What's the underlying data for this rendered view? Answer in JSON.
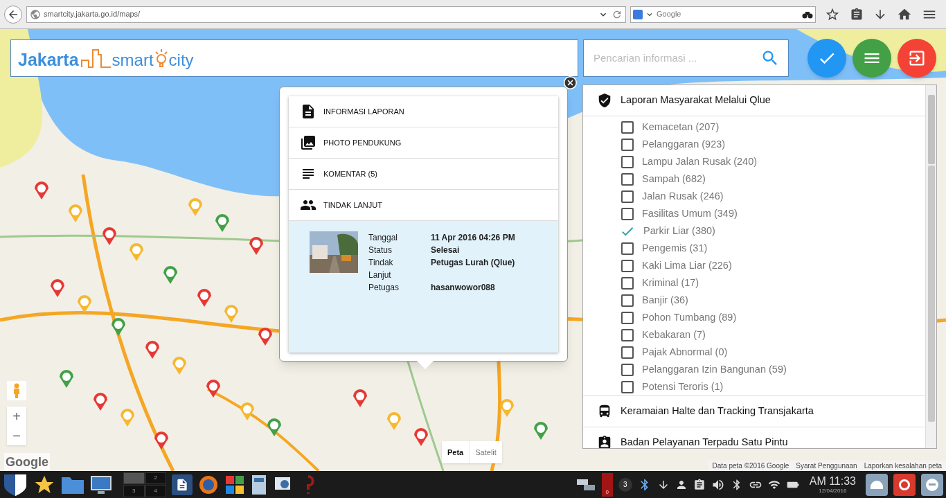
{
  "browser": {
    "url": "smartcity.jakarta.go.id/maps/",
    "search_placeholder": "Google"
  },
  "header": {
    "logo": {
      "word_1": "Jakarta",
      "word_2": "smart",
      "word_3": "city"
    },
    "search": {
      "placeholder": "Pencarian informasi ..."
    },
    "action_buttons": [
      {
        "kind": "check",
        "color": "#2196f3"
      },
      {
        "kind": "menu",
        "color": "#43a047"
      },
      {
        "kind": "exit",
        "color": "#f44336"
      }
    ]
  },
  "popup": {
    "menu": [
      {
        "kind": "document",
        "label": "INFORMASI LAPORAN"
      },
      {
        "kind": "photos",
        "label": "PHOTO PENDUKUNG"
      },
      {
        "kind": "lines",
        "label": "KOMENTAR (5)"
      },
      {
        "kind": "people",
        "label": "TINDAK LANJUT"
      }
    ],
    "details": [
      {
        "label": "Tanggal",
        "value": "11 Apr 2016 04:26 PM"
      },
      {
        "label": "Status",
        "value": "Selesai"
      },
      {
        "label": "Tindak Lanjut",
        "value": "Petugas Lurah (Qlue)"
      },
      {
        "label": "Petugas",
        "value": "hasanwowor088"
      }
    ]
  },
  "panel": {
    "sections": [
      {
        "kind": "shield",
        "title": "Laporan Masyarakat Melalui Qlue",
        "items": [
          {
            "label": "Kemacetan (207)",
            "checked": false
          },
          {
            "label": "Pelanggaran (923)",
            "checked": false
          },
          {
            "label": "Lampu Jalan Rusak (240)",
            "checked": false
          },
          {
            "label": "Sampah (682)",
            "checked": false
          },
          {
            "label": "Jalan Rusak (246)",
            "checked": false
          },
          {
            "label": "Fasilitas Umum (349)",
            "checked": false
          },
          {
            "label": "Parkir Liar (380)",
            "checked": true
          },
          {
            "label": "Pengemis (31)",
            "checked": false
          },
          {
            "label": "Kaki Lima Liar (226)",
            "checked": false
          },
          {
            "label": "Kriminal (17)",
            "checked": false
          },
          {
            "label": "Banjir (36)",
            "checked": false
          },
          {
            "label": "Pohon Tumbang (89)",
            "checked": false
          },
          {
            "label": "Kebakaran (7)",
            "checked": false
          },
          {
            "label": "Pajak Abnormal (0)",
            "checked": false
          },
          {
            "label": "Pelanggaran Izin Bangunan (59)",
            "checked": false
          },
          {
            "label": "Potensi Teroris (1)",
            "checked": false
          }
        ]
      },
      {
        "kind": "bus",
        "title": "Keramaian Halte dan Tracking Transjakarta"
      },
      {
        "kind": "badge",
        "title": "Badan Pelayanan Terpadu Satu Pintu"
      }
    ]
  },
  "map_controls": {
    "zoom": [
      "+",
      "−"
    ],
    "map_types": [
      {
        "label": "Peta",
        "selected": true
      },
      {
        "label": "Satelit",
        "selected": false
      }
    ],
    "google_logo": "Google",
    "attribution": [
      "Data peta ©2016 Google",
      "Syarat Penggunaan",
      "Laporkan kesalahan peta"
    ]
  },
  "taskbar": {
    "workspaces": [
      {
        "selected": true
      },
      {
        "label": "2",
        "selected": false
      },
      {
        "label": "3",
        "selected": false
      },
      {
        "label": "4",
        "selected": false
      }
    ],
    "red_item_count": "0",
    "badge_count": "3",
    "clock": {
      "time": "AM 11:33",
      "date": "12/04/2016"
    }
  }
}
